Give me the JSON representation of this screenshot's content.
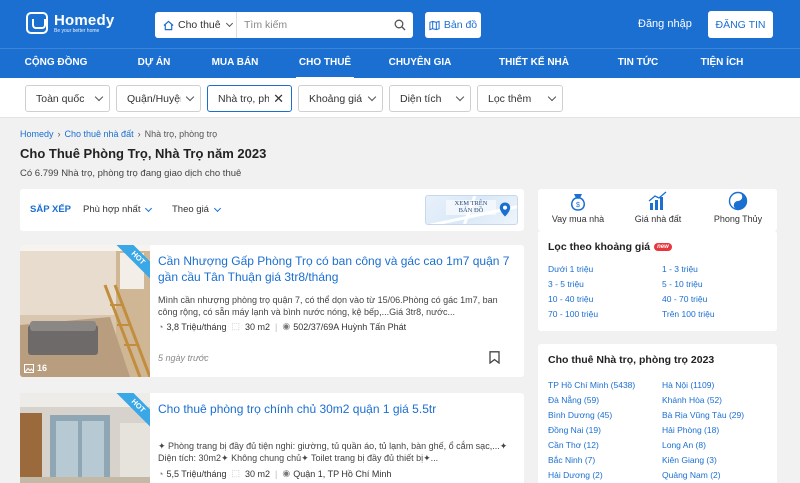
{
  "header": {
    "brand": "Homedy",
    "tagline": "Be your better home",
    "search_category": "Cho thuê",
    "search_placeholder": "Tìm kiếm",
    "map_label": "Bản đồ",
    "login_label": "Đăng nhập",
    "post_label": "ĐĂNG TIN"
  },
  "nav": {
    "items": [
      {
        "label": "CỘNG ĐỒNG"
      },
      {
        "label": "DỰ ÁN"
      },
      {
        "label": "MUA BÁN"
      },
      {
        "label": "CHO THUÊ"
      },
      {
        "label": "CHUYÊN GIA"
      },
      {
        "label": "THIẾT KẾ NHÀ ĐẸP"
      },
      {
        "label": "TIN TỨC"
      },
      {
        "label": "TIỆN ÍCH"
      }
    ],
    "active": "CHO THUÊ"
  },
  "filters": [
    {
      "value": "Toàn quốc"
    },
    {
      "value": "Quận/Huyện"
    },
    {
      "value": "Nhà trọ, phòng"
    },
    {
      "value": "Khoảng giá"
    },
    {
      "value": "Diện tích"
    },
    {
      "value": "Lọc thêm"
    }
  ],
  "breadcrumb": [
    "Homedy",
    "Cho thuê nhà đất",
    "Nhà trọ, phòng trọ"
  ],
  "page": {
    "title": "Cho Thuê Phòng Trọ, Nhà Trọ năm 2023",
    "subtitle": "Có 6.799 Nhà trọ, phòng trọ đang giao dịch cho thuê"
  },
  "sort": {
    "label": "SẮP XẾP",
    "option1": "Phù hợp nhất",
    "option2": "Theo giá",
    "map_line1": "XEM TRÊN",
    "map_line2": "BẢN ĐỒ"
  },
  "listings": [
    {
      "badge": "HOT",
      "title": "Cần Nhượng Gấp Phòng Trọ có ban công và gác cao 1m7 quận 7 gần cầu Tân Thuận giá 3tr8/tháng",
      "desc": "Mình cần nhượng phòng trọ quận 7, có thể dọn vào từ 15/06.Phòng có gác 1m7, ban công rộng, có sẵn máy lạnh và bình nước nóng, kệ bếp,...Giá 3tr8, nước...",
      "price": "3,8 Triệu/tháng",
      "area": "30 m2",
      "address": "502/37/69A Huỳnh Tấn Phát",
      "posted": "5 ngày trước",
      "photos": "16"
    },
    {
      "badge": "HOT",
      "title": "Cho thuê phòng trọ chính chủ 30m2 quận 1 giá 5.5tr",
      "desc": "✦ Phòng trang bị đầy đủ tiện nghi: giường, tủ quần áo, tủ lạnh, bàn ghế, ổ cắm sạc,...✦ Diện tích: 30m2✦ Không chung chủ✦ Toilet trang bị đầy đủ thiết bị✦...",
      "price": "5,5 Triệu/tháng",
      "area": "30 m2",
      "address": "Quận 1, TP Hồ Chí Minh"
    }
  ],
  "quick_links": [
    {
      "label": "Vay mua nhà",
      "icon": "money-bag-icon"
    },
    {
      "label": "Giá nhà đất",
      "icon": "bar-chart-icon"
    },
    {
      "label": "Phong Thủy",
      "icon": "yin-yang-icon"
    }
  ],
  "price_filter": {
    "title": "Lọc theo khoảng giá",
    "badge": "new",
    "ranges": [
      "Dưới 1 triệu",
      "1 - 3 triệu",
      "3 - 5 triệu",
      "5 - 10 triệu",
      "10 - 40 triệu",
      "40 - 70 triệu",
      "70 - 100 triệu",
      "Trên 100 triệu"
    ]
  },
  "cities": {
    "title": "Cho thuê Nhà trọ, phòng trọ 2023",
    "items": [
      "TP Hồ Chí Minh (5438)",
      "Hà Nội (1109)",
      "Đà Nẵng (59)",
      "Khánh Hòa (52)",
      "Bình Dương (45)",
      "Bà Rịa Vũng Tàu (29)",
      "Đồng Nai (19)",
      "Hải Phòng (18)",
      "Cần Thơ (12)",
      "Long An (8)",
      "Bắc Ninh (7)",
      "Kiên Giang (3)",
      "Hải Dương (2)",
      "Quảng Nam (2)"
    ]
  },
  "colors": {
    "brand": "#1b6fd1",
    "hot": "#3aa7e6",
    "new_badge": "#e8363b"
  }
}
